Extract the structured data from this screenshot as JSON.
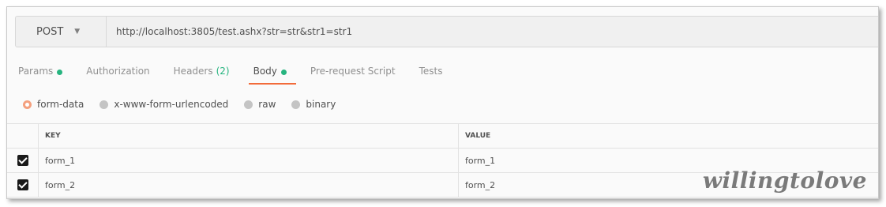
{
  "request": {
    "method": "POST",
    "url": "http://localhost:3805/test.ashx?str=str&str1=str1"
  },
  "tabs": [
    {
      "label": "Params",
      "dot": true
    },
    {
      "label": "Authorization"
    },
    {
      "label": "Headers",
      "count": "(2)"
    },
    {
      "label": "Body",
      "dot": true,
      "active": true
    },
    {
      "label": "Pre-request Script"
    },
    {
      "label": "Tests"
    }
  ],
  "body_types": [
    {
      "label": "form-data",
      "selected": true
    },
    {
      "label": "x-www-form-urlencoded"
    },
    {
      "label": "raw"
    },
    {
      "label": "binary"
    }
  ],
  "table": {
    "headers": {
      "key": "KEY",
      "value": "VALUE"
    },
    "rows": [
      {
        "key": "form_1",
        "value": "form_1",
        "checked": true
      },
      {
        "key": "form_2",
        "value": "form_2",
        "checked": true
      }
    ]
  },
  "watermark": "willingtolove",
  "colors": {
    "accent": "#f26b3a",
    "status_dot": "#26b47f",
    "radio_selected": "#f4a07e"
  }
}
